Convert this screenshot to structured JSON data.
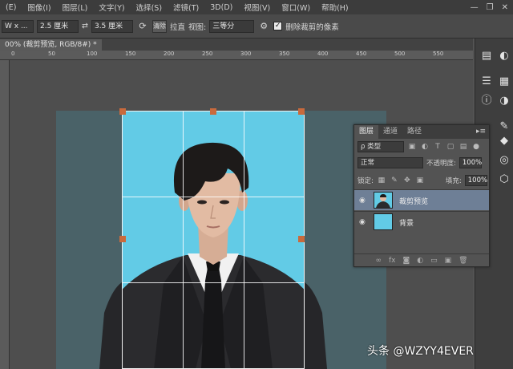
{
  "menubar": {
    "items": [
      "(E)",
      "图像(I)",
      "图层(L)",
      "文字(Y)",
      "选择(S)",
      "滤镜(T)",
      "3D(D)",
      "视图(V)",
      "窗口(W)",
      "帮助(H)"
    ],
    "controls": [
      "—",
      "❐",
      "✕"
    ]
  },
  "options": {
    "ratio": "W x ...",
    "width_value": "2.5 厘米",
    "swap": "⇄",
    "height_value": "3.5 厘米",
    "rotate_icon": "rotate-icon",
    "clear_label": "清除",
    "straighten_label": "拉直",
    "view_label": "视图:",
    "view_value": "三等分",
    "delete_checked": true,
    "delete_label": "删除裁剪的像素"
  },
  "document": {
    "tab_label": "00% (裁剪预览, RGB/8#) *"
  },
  "ruler": {
    "numbers": [
      "0",
      "50",
      "100",
      "150",
      "200",
      "250",
      "300",
      "350",
      "400",
      "450",
      "500",
      "550"
    ]
  },
  "panel": {
    "tabs": [
      "图层",
      "通道",
      "路径"
    ],
    "active_tab": "图层",
    "filter_label": "ρ 类型",
    "blend_mode": "正常",
    "opacity_label": "不透明度:",
    "opacity_value": "100%",
    "lock_label": "锁定:",
    "fill_label": "填充:",
    "fill_value": "100%",
    "layers": [
      {
        "name": "裁剪预览",
        "selected": true
      },
      {
        "name": "背景",
        "selected": false
      }
    ]
  },
  "colors": {
    "canvas_bg": "#4a6268",
    "crop_bg": "#62cbe6",
    "handle": "#c96a3d",
    "selected_layer": "#6e7f96"
  },
  "watermark": "头条 @WZYY4EVER"
}
